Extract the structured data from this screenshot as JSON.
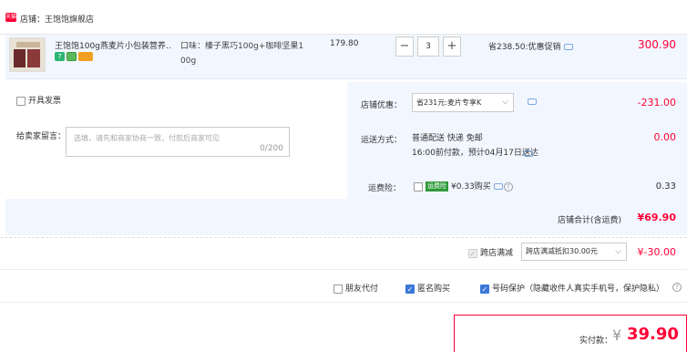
{
  "shop": {
    "badge": "天猫",
    "name": "店铺：王饱饱旗舰店"
  },
  "item": {
    "title": "王饱饱100g燕麦片小包装营养…",
    "sku_line1": "口味：榛子黑巧100g+咖啡坚果1",
    "sku_line2": "00g",
    "unit_price": "179.80",
    "quantity": "3",
    "minus": "−",
    "plus": "+",
    "discount_text": "省238.50:优惠促销",
    "subtotal": "300.90"
  },
  "invoice": {
    "label": "开具发票"
  },
  "message": {
    "label": "给卖家留言：",
    "placeholder": "选填，请先和商家协商一致，付款后商家可见",
    "count": "0/200"
  },
  "shop_coupon": {
    "label": "店铺优惠：",
    "selected": "省231元:麦片专享K",
    "amount": "-231.00"
  },
  "shipping": {
    "label": "运送方式：",
    "line1": "普通配送 快递 免邮",
    "line2": "16:00前付款，预计04月17日送达",
    "amount": "0.00"
  },
  "insurance": {
    "label": "运费险：",
    "tag": "运费险",
    "text": "¥0.33购买",
    "amount": "0.33"
  },
  "shop_total": {
    "label": "店铺合计(含运费)",
    "amount": "¥69.90"
  },
  "cross_store": {
    "label": "跨店满减",
    "selected": "跨店满减抵扣30.00元",
    "amount": "¥-30.00"
  },
  "options": {
    "friend_pay": "朋友代付",
    "anonymous": "匿名购买",
    "number_protect": "号码保护（隐藏收件人真实手机号，保护隐私）"
  },
  "payment": {
    "label": "实付款：",
    "currency": "¥",
    "amount": "39.90"
  },
  "colors": {
    "accent_red": "#ff0036",
    "panel_blue": "#f2f7ff",
    "check_blue": "#3a78d8"
  },
  "icons": [
    "tmall-badge-icon",
    "chevron-down-icon",
    "message-icon",
    "question-icon",
    "checkbox-icon"
  ]
}
